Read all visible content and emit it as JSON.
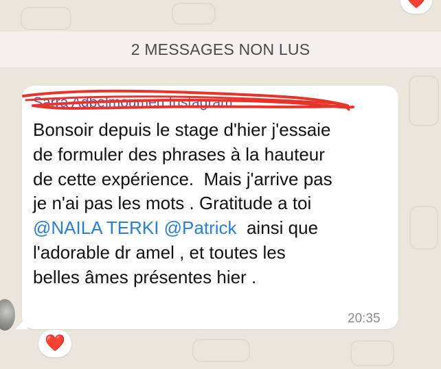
{
  "banner": {
    "text": "2 MESSAGES NON LUS"
  },
  "message": {
    "sender": "Sarra Adbelmoumen Instagram",
    "lines": [
      {
        "text": "Bonsoir depuis le stage d'hier j'essaie"
      },
      {
        "text": "de formuler des phrases à la hauteur"
      },
      {
        "text": "de cette expérience.  Mais j'arrive pas"
      },
      {
        "text": "je n'ai pas les mots . Gratitude a toi"
      },
      {
        "mention1": "@NAILA TERKI",
        "sep": " ",
        "mention2": "@Patrick",
        "rest": "  ainsi que"
      },
      {
        "text": "l'adorable dr amel , et toutes les"
      },
      {
        "text": "belles âmes présentes hier ."
      }
    ],
    "time": "20:35"
  },
  "reactions": {
    "previous_message": "❤️",
    "this_message": "❤️"
  },
  "icons": {
    "reaction_previous": "heart-icon",
    "reaction_current": "heart-icon",
    "avatar": "contact-avatar"
  },
  "colors": {
    "chat_background": "#ebe5dc",
    "bubble": "#ffffff",
    "mention": "#2a7ed3",
    "sender_name": "#6f4b99",
    "scribble": "#e8332b",
    "time": "#8a8a8a"
  }
}
